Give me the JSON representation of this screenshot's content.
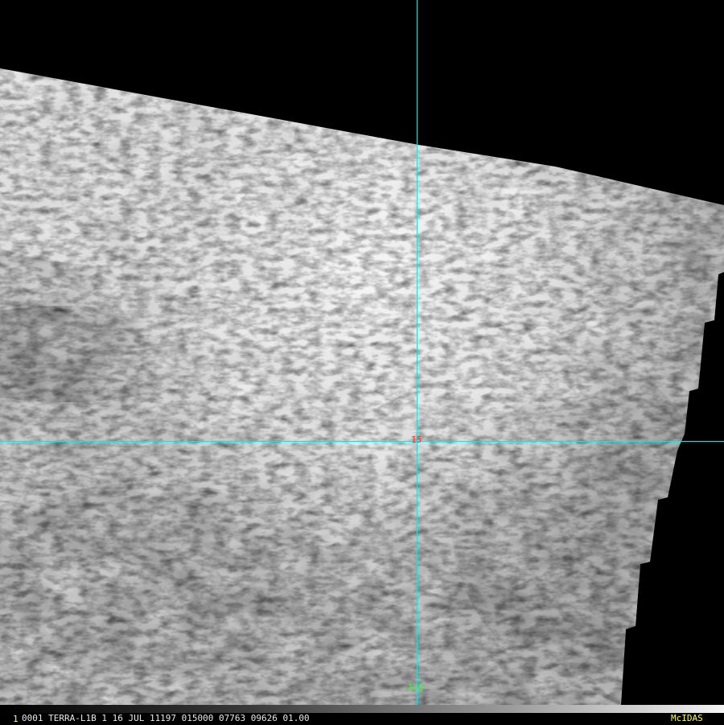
{
  "satellite_view": {
    "grid": {
      "line_color": "#22dddd",
      "latitude_label": "15",
      "latitude_label_color": "#ff3030",
      "longitude_label": "-140",
      "longitude_label_color": "#30ff30"
    }
  },
  "status_bar": {
    "frame_number": "1",
    "frame_number_color": "#ffff40",
    "image_info": "0001 TERRA-L1B  1 16 JUL 11197 015000 07763 09626 01.00",
    "software": "McIDAS",
    "software_color": "#ffff40"
  }
}
